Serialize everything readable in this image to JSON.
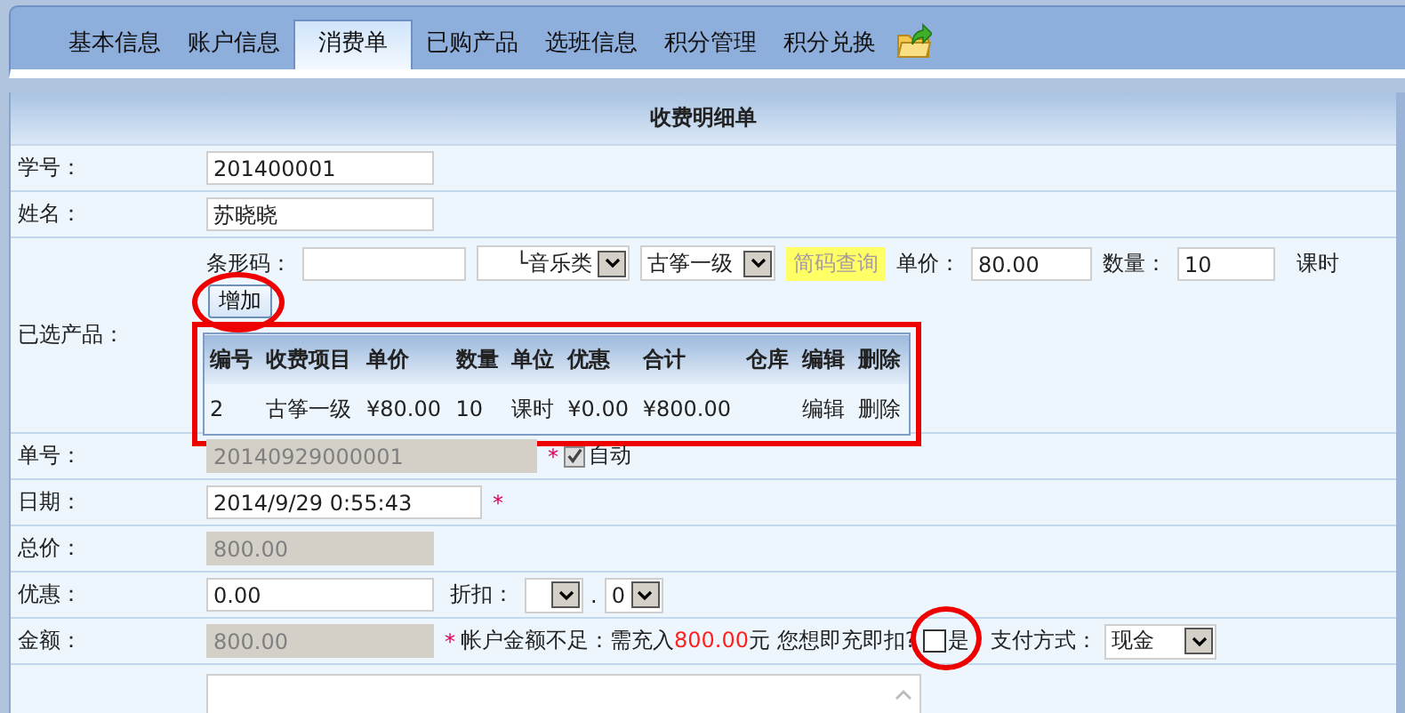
{
  "tabs": [
    {
      "label": "基本信息",
      "selected": false
    },
    {
      "label": "账户信息",
      "selected": false
    },
    {
      "label": "消费单",
      "selected": true
    },
    {
      "label": "已购产品",
      "selected": false
    },
    {
      "label": "选班信息",
      "selected": false
    },
    {
      "label": "积分管理",
      "selected": false
    },
    {
      "label": "积分兑换",
      "selected": false
    }
  ],
  "panel_title": "收费明细单",
  "student_id": {
    "label": "学号：",
    "value": "201400001"
  },
  "name": {
    "label": "姓名：",
    "value": "苏晓晓"
  },
  "products": {
    "label": "已选产品：",
    "barcode_label": "条形码：",
    "category": "└音乐类",
    "item": "古筝一级",
    "lookup_button": "简码查询",
    "price_label": "单价：",
    "price": "80.00",
    "qty_label": "数量：",
    "qty": "10",
    "unit": "课时",
    "add_button": "增加",
    "table": {
      "columns": [
        "编号",
        "收费项目",
        "单价",
        "数量",
        "单位",
        "优惠",
        "合计",
        "仓库",
        "编辑",
        "删除"
      ],
      "rows": [
        [
          "2",
          "古筝一级",
          "¥80.00",
          "10",
          "课时",
          "¥0.00",
          "¥800.00",
          null,
          "编辑",
          "删除"
        ]
      ]
    }
  },
  "order_no": {
    "label": "单号：",
    "value": "20140929000001",
    "disabled": true,
    "required_mark": "*",
    "auto_label": "自动",
    "auto_checked": true
  },
  "date": {
    "label": "日期：",
    "value": "2014/9/29 0:55:43",
    "disabled": false,
    "required_mark": "*"
  },
  "total": {
    "label": "总价：",
    "value": "800.00",
    "disabled": true
  },
  "discount": {
    "label": "优惠：",
    "value": "0.00",
    "disabled": false,
    "rate_label": "折扣：",
    "rate_separator": ".",
    "rate_decimal": "0"
  },
  "amount": {
    "label": "金额：",
    "value": "800.00",
    "disabled": true,
    "required_mark": "*",
    "note_before": "帐户金额不足：需充入",
    "note_amount": "800.00",
    "note_after": "元 您想即充即扣?",
    "instant_label": "是",
    "instant_checked": false,
    "payment_label": "支付方式：",
    "payment_value": "现金"
  }
}
